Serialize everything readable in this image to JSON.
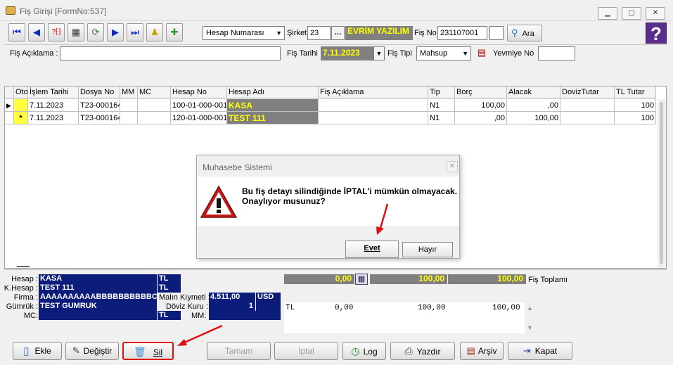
{
  "window": {
    "title": "Fiş Girişi [FormNo:537]"
  },
  "toolbar": {
    "account_select": "Hesap Numarası",
    "sirket_label": "Şirket",
    "sirket_value": "23",
    "company_name": "EVRİM YAZILIM",
    "fis_no_label": "Fiş No",
    "fis_no_value": "231107001",
    "ara_label": "Ara",
    "help_label": "?"
  },
  "header": {
    "aciklama_label": "Fiş Açıklama :",
    "aciklama_value": "",
    "tarih_label": "Fiş Tarihi",
    "tarih_value": "7.11.2023",
    "tipi_label": "Fiş  Tipi",
    "tipi_value": "Mahsup",
    "yevmiye_label": "Yevmiye No",
    "yevmiye_value": ""
  },
  "grid": {
    "columns": [
      "Oto",
      "İşlem Tarihi",
      "Dosya No",
      "MM",
      "MC",
      "Hesap No",
      "Hesap Adı",
      "Fiş Açıklama",
      "Tip",
      "Borç",
      "Alacak",
      "DovizTutar",
      "TL Tutar"
    ],
    "rows": [
      {
        "marker": "▶",
        "oto": "",
        "tarih": "7.11.2023",
        "dosya": "T23-000164",
        "mm": "",
        "mc": "",
        "hesap_no": "100-01-000-001",
        "hesap_adi": "KASA",
        "aciklama": "",
        "tip": "N1",
        "borc": "100,00",
        "alacak": ",00",
        "doviz": "",
        "tl": "100"
      },
      {
        "marker": "",
        "oto": "*",
        "tarih": "7.11.2023",
        "dosya": "T23-000164",
        "mm": "",
        "mc": "",
        "hesap_no": "120-01-000-001",
        "hesap_adi": "TEST 111",
        "aciklama": "",
        "tip": "N1",
        "borc": ",00",
        "alacak": "100,00",
        "doviz": "",
        "tl": "100"
      }
    ]
  },
  "dialog": {
    "title": "Muhasebe Sistemi",
    "message_line1": "Bu fiş detayı silindiğinde İPTAL'i mümkün olmayacak.",
    "message_line2": "Onaylıyor musunuz?",
    "yes_label": "Evet",
    "no_label": "Hayır"
  },
  "summary": {
    "hesap_label": "Hesap :",
    "hesap_value": "KASA",
    "hesap_cur": "TL",
    "khesap_label": "K.Hesap :",
    "khesap_value": "TEST 111",
    "khesap_cur": "TL",
    "firma_label": "Firma :",
    "firma_value": "AAAAAAAAAABBBBBBBBBBC",
    "gumruk_label": "Gümrük :",
    "gumruk_value": "TEST GUMRUK",
    "mc_label": "MC:",
    "mc_cur": "TL",
    "malin_label": "Malın Kıymeti :",
    "malin_value": "4.511,00",
    "malin_cur": "USD",
    "doviz_label": "Döviz Kuru :",
    "doviz_value": "1",
    "mm_label": "MM:",
    "total_1": "0,00",
    "total_2": "100,00",
    "total_3": "100,00",
    "fis_toplami_label": "Fiş Toplamı",
    "tl_row": {
      "cur": "TL",
      "v1": "0,00",
      "v2": "100,00",
      "v3": "100,00"
    }
  },
  "buttons": {
    "ekle": "Ekle",
    "degistir": "Değiştir",
    "sil": "Sil",
    "tamam": "Tamam",
    "iptal": "İptal",
    "log": "Log",
    "yazdir": "Yazdır",
    "arsiv": "Arşiv",
    "kapat": "Kapat"
  },
  "colors": {
    "highlight": "#e01010",
    "navy": "#0c1c7a",
    "yellow": "#ffff00",
    "help": "#5b2d8c"
  }
}
